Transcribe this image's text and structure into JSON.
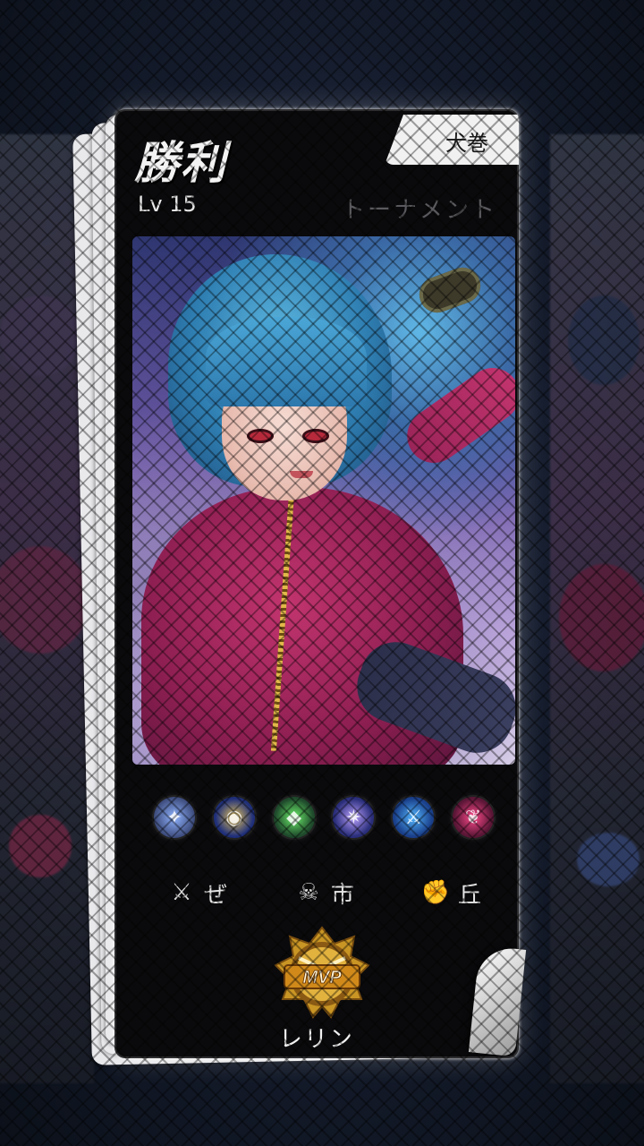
{
  "result": {
    "title": "勝利",
    "level": "Lv 15",
    "mode_tab": "犬巻",
    "mode": "トーナメント"
  },
  "items": [
    {
      "icon": "boots-item-icon",
      "color": "#3c4a7a",
      "accent": "#8fb3ff"
    },
    {
      "icon": "blue-orb-item-icon",
      "color": "#1f2f7a",
      "accent": "#e2c15a"
    },
    {
      "icon": "green-crystal-item-icon",
      "color": "#1f4a2c",
      "accent": "#6cf06a"
    },
    {
      "icon": "lightning-orb-item-icon",
      "color": "#2a2e7a",
      "accent": "#b9a0ff"
    },
    {
      "icon": "blue-blade-item-icon",
      "color": "#1a3f8a",
      "accent": "#53b6ff"
    },
    {
      "icon": "demon-wing-item-icon",
      "color": "#5a1636",
      "accent": "#ff4a8c"
    }
  ],
  "stats": {
    "kills_icon": "crossed-swords-icon",
    "kills": "ぜ",
    "deaths_icon": "skull-icon",
    "deaths": "市",
    "assists_icon": "fist-icon",
    "assists": "丘"
  },
  "mvp": {
    "badge_text": "MVP",
    "player_name": "レリン"
  },
  "colors": {
    "gold": "#e2b23e",
    "card_bg": "#0a0a0c"
  }
}
